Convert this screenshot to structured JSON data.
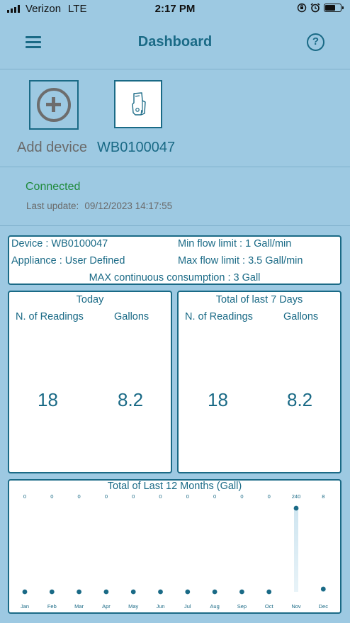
{
  "status_bar": {
    "carrier": "Verizon",
    "network": "LTE",
    "time": "2:17 PM"
  },
  "header": {
    "title": "Dashboard",
    "help": "?"
  },
  "devices": {
    "add_label": "Add device",
    "device_label": "WB0100047"
  },
  "connection": {
    "status": "Connected",
    "last_update_label": "Last update:",
    "last_update_value": "09/12/2023 14:17:55"
  },
  "info": {
    "device": "Device : WB0100047",
    "min_flow": "Min flow limit : 1 Gall/min",
    "appliance": "Appliance : User Defined",
    "max_flow": "Max flow limit : 3.5 Gall/min",
    "max_continuous": "MAX continuous consumption : 3 Gall"
  },
  "today": {
    "title": "Today",
    "readings_label": "N. of Readings",
    "gallons_label": "Gallons",
    "readings": "18",
    "gallons": "8.2"
  },
  "week": {
    "title": "Total of last 7 Days",
    "readings_label": "N. of Readings",
    "gallons_label": "Gallons",
    "readings": "18",
    "gallons": "8.2"
  },
  "colors": {
    "background": "#9dc9e2",
    "accent": "#1a6a86",
    "connected": "#1f8a3c",
    "muted": "#6a6a6a"
  },
  "icons": {
    "menu": "menu-icon",
    "help": "help-icon",
    "add": "add-circle-icon",
    "device": "water-meter-icon"
  },
  "chart_data": {
    "type": "bar",
    "title": "Total of Last 12 Months (Gall)",
    "categories": [
      "Jan",
      "Feb",
      "Mar",
      "Apr",
      "May",
      "Jun",
      "Jul",
      "Aug",
      "Sep",
      "Oct",
      "Nov",
      "Dec"
    ],
    "values": [
      0,
      0,
      0,
      0,
      0,
      0,
      0,
      0,
      0,
      0,
      240,
      8
    ],
    "ylim": [
      0,
      240
    ]
  }
}
